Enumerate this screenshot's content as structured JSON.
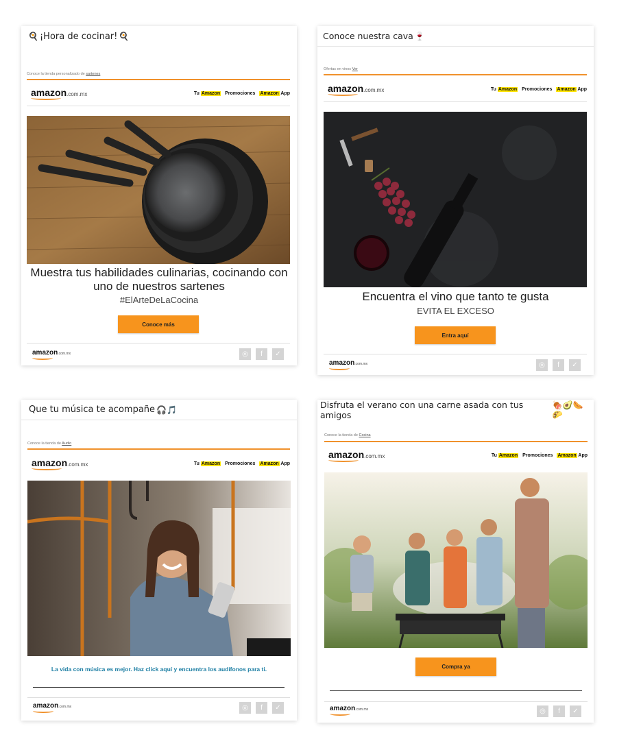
{
  "brand": {
    "logo_text": "amazon",
    "logo_domain": ".com.mx",
    "accent": "#f7941d",
    "highlight": "#ffe500"
  },
  "nav": {
    "tu": "Tu",
    "amazon": "Amazon",
    "promociones": "Promociones",
    "app": "App"
  },
  "social": {
    "instagram_icon": "◎",
    "facebook_icon": "f",
    "twitter_icon": "✓"
  },
  "card1": {
    "subject": "¡Hora de cocinar!",
    "emoji_left": "🍳",
    "emoji_right": "🍳",
    "preheader_text": "Conoce la tienda personalizado de",
    "preheader_link": "sartenes",
    "headline": "Muestra tus habilidades culinarias, cocinando con uno de nuestros sartenes",
    "hashtag": "#ElArteDeLaCocina",
    "cta": "Conoce más"
  },
  "card2": {
    "subject": "Conoce nuestra cava",
    "emoji": "🍷",
    "preheader_text": "Ofertas en vinos",
    "preheader_link": "Ver",
    "headline": "Encuentra el vino que tanto te gusta",
    "subheadline": "EVITA EL EXCESO",
    "cta": "Entra aquí"
  },
  "card3": {
    "subject": "Que tu música te acompañe",
    "emoji": "🎧🎵",
    "preheader_text": "Conoce la tienda de",
    "preheader_link": "Audio",
    "body_link": "La vida con música es mejor. Haz click aquí y encuentra los audífonos para ti."
  },
  "card4": {
    "subject": "Disfruta el verano con una carne asada con tus amigos",
    "emoji": "🍖🥑🌭🌮",
    "preheader_text": "Conoce la tienda de",
    "preheader_link": "Cocina",
    "cta": "Compra ya"
  }
}
